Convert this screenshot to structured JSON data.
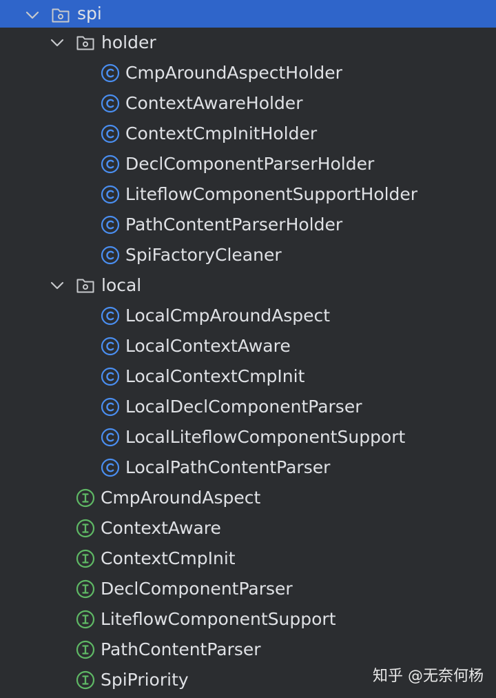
{
  "tree": {
    "root": {
      "label": "spi",
      "expanded": true,
      "icon": "package-folder-icon"
    },
    "holder": {
      "label": "holder",
      "expanded": true,
      "icon": "package-folder-icon",
      "classes": [
        "CmpAroundAspectHolder",
        "ContextAwareHolder",
        "ContextCmpInitHolder",
        "DeclComponentParserHolder",
        "LiteflowComponentSupportHolder",
        "PathContentParserHolder",
        "SpiFactoryCleaner"
      ]
    },
    "local": {
      "label": "local",
      "expanded": true,
      "icon": "package-folder-icon",
      "classes": [
        "LocalCmpAroundAspect",
        "LocalContextAware",
        "LocalContextCmpInit",
        "LocalDeclComponentParser",
        "LocalLiteflowComponentSupport",
        "LocalPathContentParser"
      ]
    },
    "interfaces": [
      "CmpAroundAspect",
      "ContextAware",
      "ContextCmpInit",
      "DeclComponentParser",
      "LiteflowComponentSupport",
      "PathContentParser",
      "SpiPriority"
    ]
  },
  "watermark": "知乎 @无奈何杨",
  "colors": {
    "background": "#2b2d30",
    "selection": "#2f65ca",
    "text": "#dfe1e5",
    "class_icon": "#4a8ef0",
    "interface_icon": "#5fb865"
  }
}
